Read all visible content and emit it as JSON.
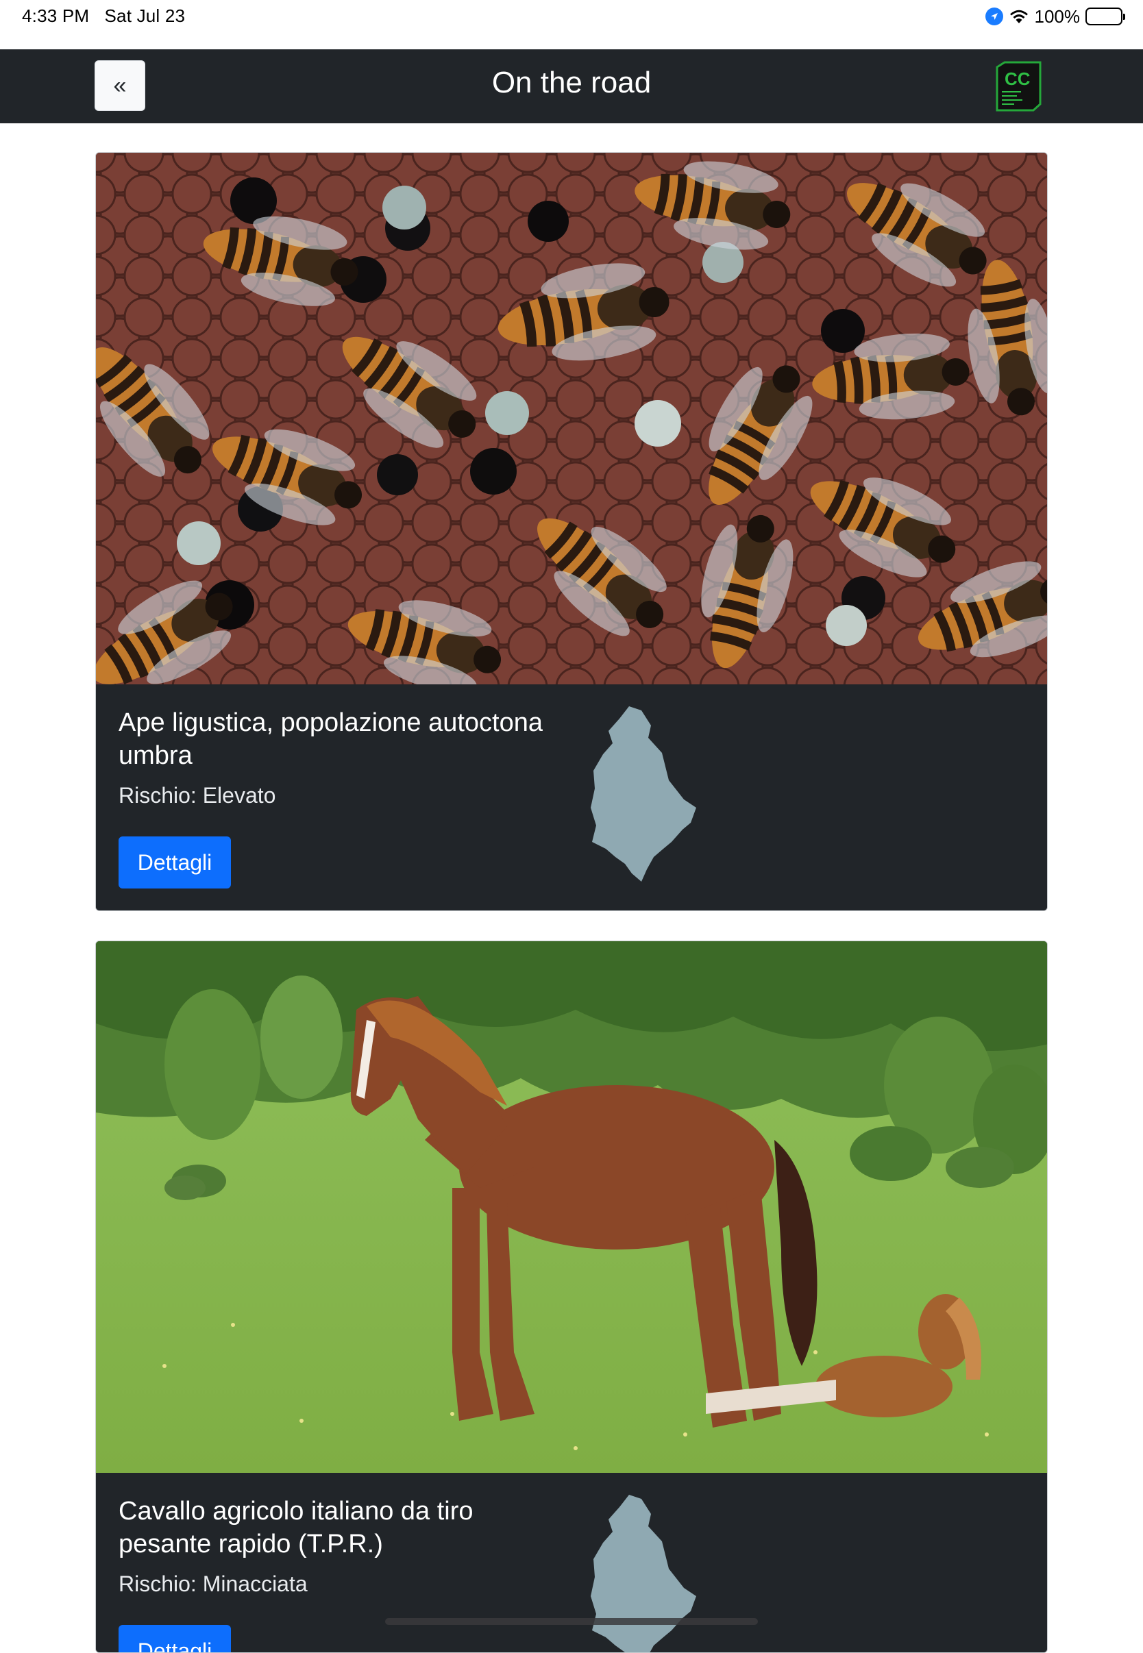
{
  "status_bar": {
    "time": "4:33 PM",
    "date": "Sat Jul 23",
    "battery": "100%",
    "icons": [
      "location-icon",
      "wifi-icon",
      "battery-icon"
    ]
  },
  "navbar": {
    "back_label": "«",
    "title": "On the road",
    "logo_icon": "cc-logo-icon"
  },
  "cards": [
    {
      "title": "Ape ligustica, popolazione autoctona umbra",
      "risk": "Rischio: Elevato",
      "button_label": "Dettagli",
      "image_icon": "bees-photo",
      "region_icon": "umbria-region-icon"
    },
    {
      "title": "Cavallo agricolo italiano da tiro pesante rapido (T.P.R.)",
      "risk": "Rischio: Minacciata",
      "button_label": "Dettagli",
      "image_icon": "horse-photo",
      "region_icon": "umbria-region-icon"
    }
  ],
  "colors": {
    "navbar": "#212529",
    "primary_button": "#0d6efd",
    "region_fill": "#8fa9b2"
  }
}
